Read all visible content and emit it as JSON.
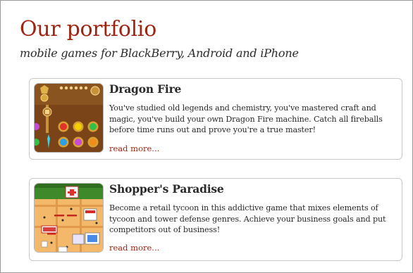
{
  "header": {
    "title": "Our portfolio",
    "subtitle": "mobile games for BlackBerry, Android and iPhone"
  },
  "games": [
    {
      "title": "Dragon Fire",
      "description": "You've studied old legends and chemistry, you've mastered craft and magic, you've build your own Dragon Fire machine.  Catch all fireballs before time runs out and prove you're a true master!",
      "link": "read more...",
      "thumbnail_icon": "dragon-fire-game-thumbnail"
    },
    {
      "title": "Shopper's Paradise",
      "description": "Become a retail tycoon in this addictive game that mixes elements of tycoon and tower defense genres. Achieve your business goals and put competitors out of business!",
      "link": "read more...",
      "thumbnail_icon": "shoppers-paradise-game-thumbnail"
    }
  ],
  "colors": {
    "accent": "#9e2411",
    "text": "#2a2a2a",
    "card_border": "#c9c9c9"
  }
}
